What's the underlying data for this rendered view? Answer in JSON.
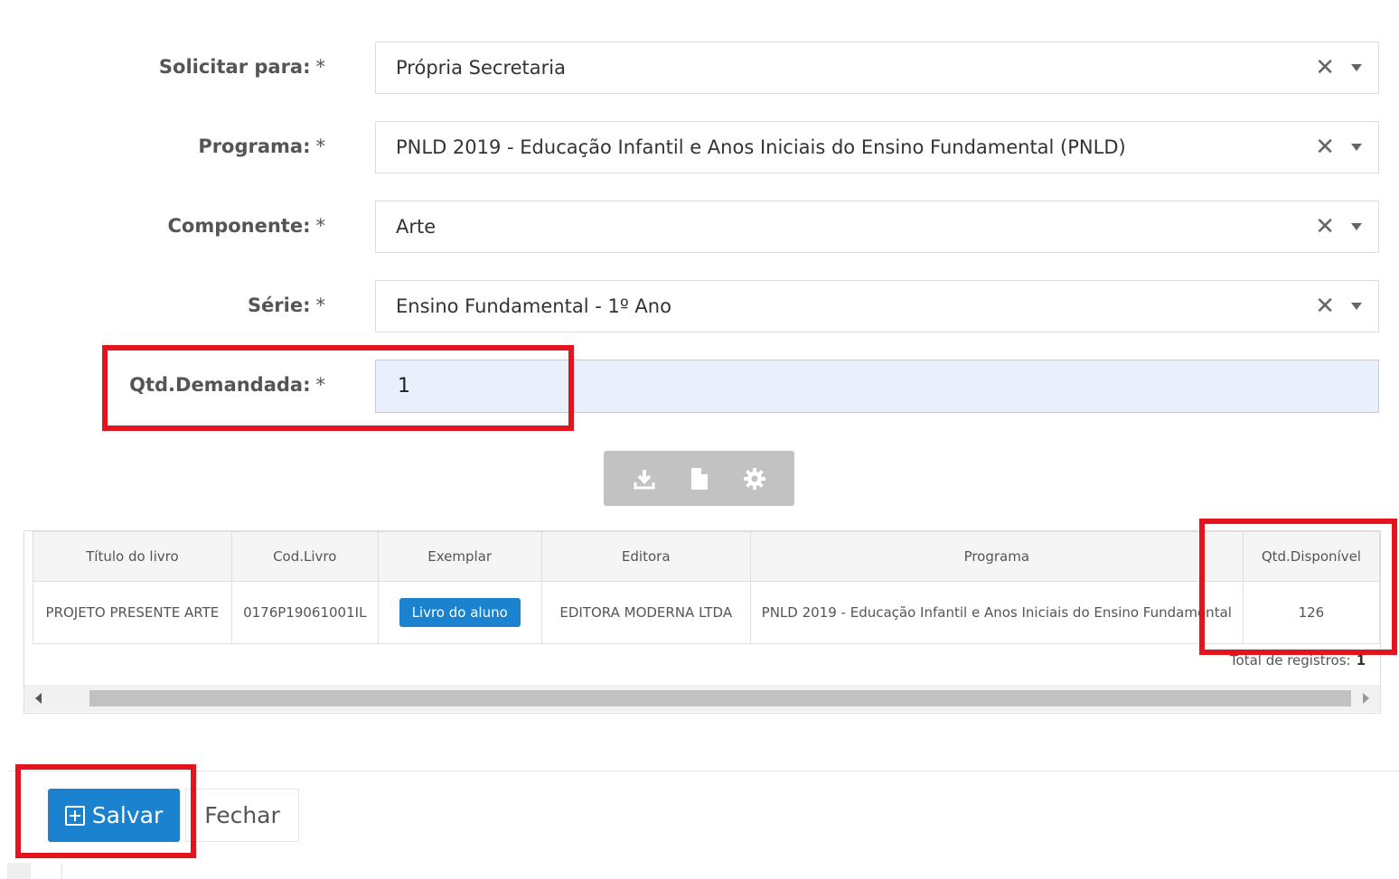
{
  "form": {
    "solicitar_para": {
      "label": "Solicitar para:",
      "required": "*",
      "value": "Própria Secretaria"
    },
    "programa": {
      "label": "Programa:",
      "required": "*",
      "value": "PNLD 2019 - Educação Infantil e Anos Iniciais do Ensino Fundamental (PNLD)"
    },
    "componente": {
      "label": "Componente:",
      "required": "*",
      "value": "Arte"
    },
    "serie": {
      "label": "Série:",
      "required": "*",
      "value": "Ensino Fundamental - 1º Ano"
    },
    "qtd_demandada": {
      "label": "Qtd.Demandada:",
      "required": "*",
      "value": "1"
    },
    "clear_glyph": "✕"
  },
  "toolbar": {
    "icons": [
      "download-icon",
      "file-icon",
      "gear-icon"
    ]
  },
  "grid": {
    "headers": [
      "Título do livro",
      "Cod.Livro",
      "Exemplar",
      "Editora",
      "Programa",
      "Qtd.Disponível"
    ],
    "rows": [
      {
        "titulo": "PROJETO PRESENTE ARTE",
        "cod": "0176P19061001IL",
        "exemplar": "Livro do aluno",
        "editora": "EDITORA MODERNA LTDA",
        "programa": "PNLD 2019 - Educação Infantil e Anos Iniciais do Ensino Fundamental",
        "qtd": "126"
      }
    ],
    "total_label": "Total de registros:",
    "total_value": "1"
  },
  "footer": {
    "save_label": "Salvar",
    "close_label": "Fechar"
  },
  "colors": {
    "primary": "#1b82d0",
    "highlight": "#e3141e",
    "input_autofill": "#e8f0fe"
  }
}
